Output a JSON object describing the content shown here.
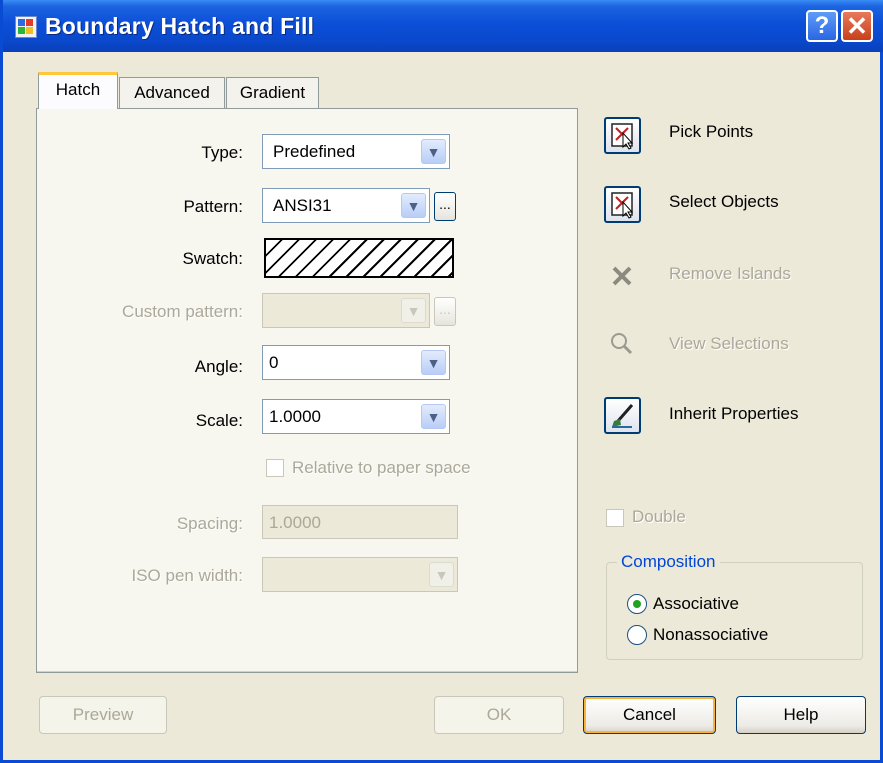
{
  "window": {
    "title": "Boundary Hatch and Fill",
    "help_glyph": "?",
    "close_glyph": "✕"
  },
  "tabs": [
    {
      "label": "Hatch"
    },
    {
      "label": "Advanced"
    },
    {
      "label": "Gradient"
    }
  ],
  "hatch": {
    "type_label": "Type:",
    "type_value": "Predefined",
    "pattern_label": "Pattern:",
    "pattern_value": "ANSI31",
    "swatch_label": "Swatch:",
    "custom_pattern_label": "Custom pattern:",
    "angle_label": "Angle:",
    "angle_value": "0",
    "scale_label": "Scale:",
    "scale_value": "1.0000",
    "relative_label": "Relative to paper space",
    "spacing_label": "Spacing:",
    "spacing_value": "1.0000",
    "iso_label": "ISO pen width:",
    "ellipsis": "...",
    "dropdown_glyph": "▼"
  },
  "actions": {
    "pick_points": "Pick Points",
    "select_objects": "Select Objects",
    "remove_islands": "Remove Islands",
    "view_selections": "View Selections",
    "inherit_properties": "Inherit Properties"
  },
  "double_label": "Double",
  "composition": {
    "title": "Composition",
    "associative": "Associative",
    "nonassociative": "Nonassociative",
    "selected": "Associative"
  },
  "buttons": {
    "preview": "Preview",
    "ok": "OK",
    "cancel": "Cancel",
    "help": "Help"
  },
  "colors": {
    "titlebar": "#0a4bd4",
    "dialog_bg": "#ece9d8",
    "disabled_text": "#aca899",
    "accent_tab": "#ffc83c"
  }
}
